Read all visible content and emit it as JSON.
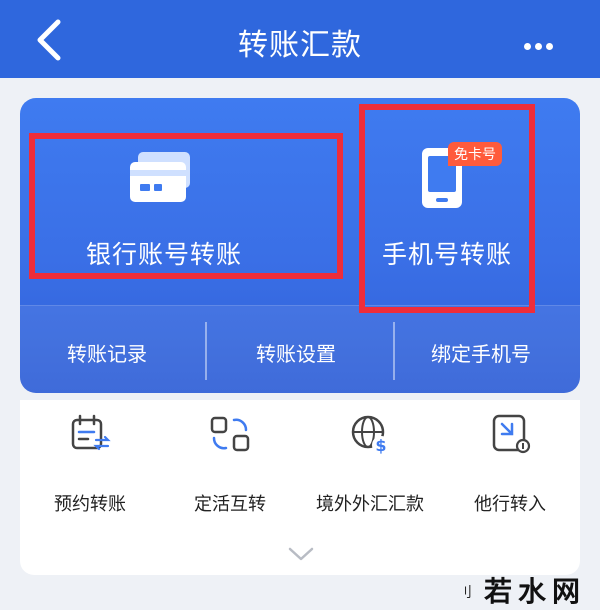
{
  "header": {
    "title": "转账汇款"
  },
  "card": {
    "bank_transfer_label": "银行账号转账",
    "phone_transfer_label": "手机号转账",
    "phone_badge": "免卡号",
    "links": [
      "转账记录",
      "转账设置",
      "绑定手机号"
    ]
  },
  "shortcuts": [
    {
      "label": "预约转账",
      "icon": "calendar-transfer-icon"
    },
    {
      "label": "定活互转",
      "icon": "swap-blocks-icon"
    },
    {
      "label": "境外外汇汇款",
      "icon": "globe-dollar-icon"
    },
    {
      "label": "他行转入",
      "icon": "incoming-transfer-icon"
    }
  ],
  "watermark": {
    "text": "若水网",
    "mark": "刂"
  },
  "colors": {
    "header": "#2f67dd",
    "card": "#3a6fe6",
    "highlight": "#ee2d3a",
    "badge": "#ff5b3b"
  }
}
